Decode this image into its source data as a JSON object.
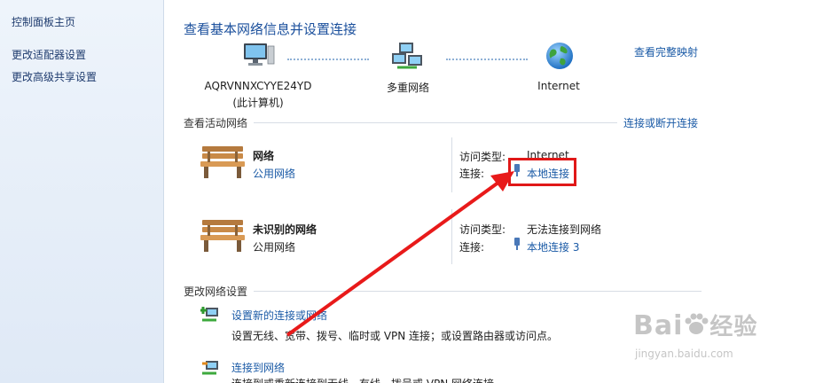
{
  "sidebar": {
    "items": [
      {
        "label": "控制面板主页"
      },
      {
        "label": "更改适配器设置"
      },
      {
        "label": "更改高级共享设置"
      }
    ]
  },
  "header": {
    "title": "查看基本网络信息并设置连接",
    "view_full_map": "查看完整映射"
  },
  "network_map": {
    "computer_name": "AQRVNNXCYYE24YD",
    "computer_sub": "(此计算机)",
    "middle_label": "多重网络",
    "internet_label": "Internet"
  },
  "active_networks": {
    "section_title": "查看活动网络",
    "connect_disconnect": "连接或断开连接",
    "networks": [
      {
        "name": "网络",
        "type": "公用网络",
        "access_label": "访问类型:",
        "access_value": "Internet",
        "conn_label": "连接:",
        "conn_value": "本地连接"
      },
      {
        "name": "未识别的网络",
        "type": "公用网络",
        "access_label": "访问类型:",
        "access_value": "无法连接到网络",
        "conn_label": "连接:",
        "conn_value": "本地连接 3"
      }
    ]
  },
  "change_settings": {
    "section_title": "更改网络设置",
    "tasks": [
      {
        "title": "设置新的连接或网络",
        "desc": "设置无线、宽带、拨号、临时或 VPN 连接；或设置路由器或访问点。"
      },
      {
        "title": "连接到网络",
        "desc": "连接到或重新连接到无线、有线、拨号或 VPN 网络连接。"
      }
    ]
  },
  "watermark": {
    "brand": "Bai",
    "brand_cn": "经验",
    "url": "jingyan.baidu.com"
  },
  "colors": {
    "link": "#1a5aa6",
    "title": "#1a4f9c",
    "highlight": "#e01818",
    "arrow": "#e81a1a",
    "sidebar_top": "#eef4fb"
  }
}
